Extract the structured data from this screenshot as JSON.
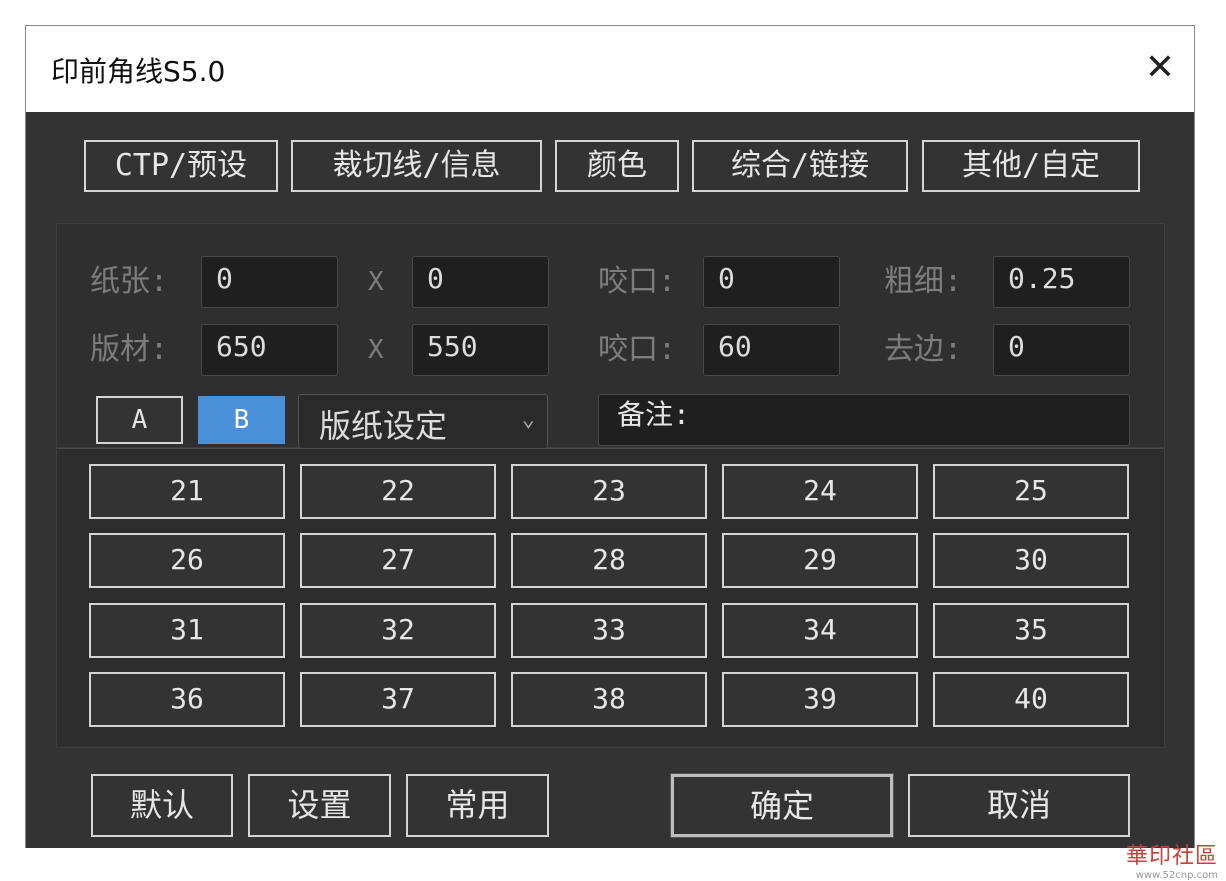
{
  "window": {
    "title": "印前角线S5.0",
    "close_glyph": "✕"
  },
  "tabs": [
    "CTP/预设",
    "裁切线/信息",
    "颜色",
    "综合/链接",
    "其他/自定"
  ],
  "fields": {
    "row1": {
      "paper_label": "纸张:",
      "paper_w": "0",
      "x_label": "X",
      "paper_h": "0",
      "bite_label": "咬口:",
      "bite": "0",
      "weight_label": "粗细:",
      "weight": "0.25"
    },
    "row2": {
      "plate_label": "版材:",
      "plate_w": "650",
      "x_label": "X",
      "plate_h": "550",
      "bite_label": "咬口:",
      "bite": "60",
      "trim_label": "去边:",
      "trim": "0"
    }
  },
  "ab": {
    "a": "A",
    "b": "B",
    "active": "B",
    "active_color": "#4a90d9"
  },
  "preset_select": {
    "value": "版纸设定",
    "arrow": "⌄"
  },
  "note": {
    "label": "备注:"
  },
  "grid": [
    [
      "21",
      "22",
      "23",
      "24",
      "25"
    ],
    [
      "26",
      "27",
      "28",
      "29",
      "30"
    ],
    [
      "31",
      "32",
      "33",
      "34",
      "35"
    ],
    [
      "36",
      "37",
      "38",
      "39",
      "40"
    ]
  ],
  "bottom": {
    "default": "默认",
    "settings": "设置",
    "common": "常用",
    "ok": "确定",
    "cancel": "取消"
  },
  "watermark": {
    "text": "華印社區",
    "url": "www.52cnp.com"
  }
}
